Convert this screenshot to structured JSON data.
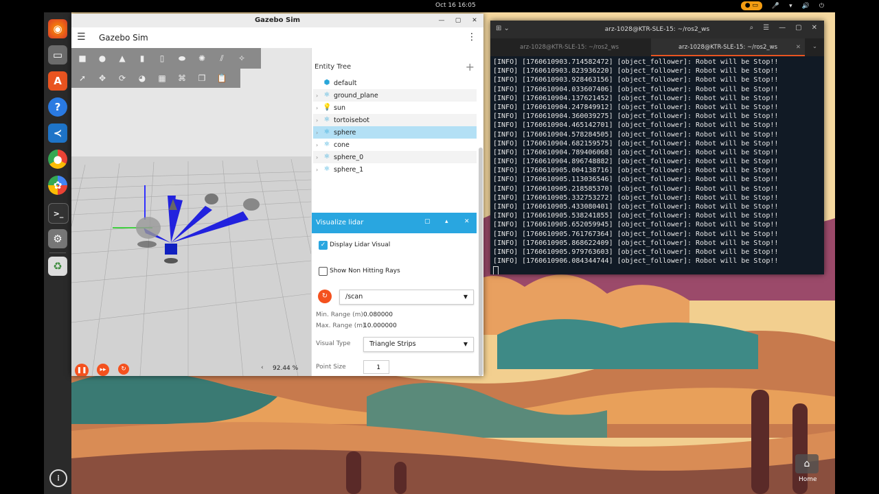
{
  "topbar": {
    "clock": "Oct 16  16:05"
  },
  "gazebo": {
    "window_title": "Gazebo Sim",
    "app_name": "Gazebo Sim",
    "rtf": "92.44 %",
    "entity_tree": {
      "title": "Entity Tree",
      "items": [
        {
          "label": "default",
          "icon": "world-cube-icon"
        },
        {
          "label": "ground_plane",
          "icon": "model-icon"
        },
        {
          "label": "sun",
          "icon": "light-icon"
        },
        {
          "label": "tortoisebot",
          "icon": "model-icon"
        },
        {
          "label": "sphere",
          "icon": "model-icon"
        },
        {
          "label": "cone",
          "icon": "model-icon"
        },
        {
          "label": "sphere_0",
          "icon": "model-icon"
        },
        {
          "label": "sphere_1",
          "icon": "model-icon"
        }
      ]
    },
    "lidar": {
      "title": "Visualize lidar",
      "display_visual_label": "Display Lidar Visual",
      "display_visual_checked": true,
      "non_hitting_label": "Show Non Hitting Rays",
      "non_hitting_checked": false,
      "topic": "/scan",
      "min_range_label": "Min. Range (m)",
      "min_range": "0.080000",
      "max_range_label": "Max. Range (m)",
      "max_range": "10.000000",
      "visual_type_label": "Visual Type",
      "visual_type": "Triangle Strips",
      "point_size_label": "Point Size",
      "point_size": "1"
    },
    "accent": "#29a6e0",
    "button_color": "#f4511e"
  },
  "terminal": {
    "title": "arz-1028@KTR-SLE-15: ~/ros2_ws",
    "tabs": [
      "arz-1028@KTR-SLE-15: ~/ros2_ws",
      "arz-1028@KTR-SLE-15: ~/ros2_ws"
    ],
    "lines": [
      "[INFO] [1760610903.714582472] [object_follower]: Robot will be Stop!!",
      "[INFO] [1760610903.823936220] [object_follower]: Robot will be Stop!!",
      "[INFO] [1760610903.928463156] [object_follower]: Robot will be Stop!!",
      "[INFO] [1760610904.033607406] [object_follower]: Robot will be Stop!!",
      "[INFO] [1760610904.137621452] [object_follower]: Robot will be Stop!!",
      "[INFO] [1760610904.247849912] [object_follower]: Robot will be Stop!!",
      "[INFO] [1760610904.360039275] [object_follower]: Robot will be Stop!!",
      "[INFO] [1760610904.465142701] [object_follower]: Robot will be Stop!!",
      "[INFO] [1760610904.578284505] [object_follower]: Robot will be Stop!!",
      "[INFO] [1760610904.682159575] [object_follower]: Robot will be Stop!!",
      "[INFO] [1760610904.789406068] [object_follower]: Robot will be Stop!!",
      "[INFO] [1760610904.896748882] [object_follower]: Robot will be Stop!!",
      "[INFO] [1760610905.004138716] [object_follower]: Robot will be Stop!!",
      "[INFO] [1760610905.113036546] [object_follower]: Robot will be Stop!!",
      "[INFO] [1760610905.218585370] [object_follower]: Robot will be Stop!!",
      "[INFO] [1760610905.332753272] [object_follower]: Robot will be Stop!!",
      "[INFO] [1760610905.433080401] [object_follower]: Robot will be Stop!!",
      "[INFO] [1760610905.538241855] [object_follower]: Robot will be Stop!!",
      "[INFO] [1760610905.652059945] [object_follower]: Robot will be Stop!!",
      "[INFO] [1760610905.761767364] [object_follower]: Robot will be Stop!!",
      "[INFO] [1760610905.868622409] [object_follower]: Robot will be Stop!!",
      "[INFO] [1760610905.979763603] [object_follower]: Robot will be Stop!!",
      "[INFO] [1760610906.084344744] [object_follower]: Robot will be Stop!!"
    ]
  },
  "desktop": {
    "home_label": "Home"
  }
}
